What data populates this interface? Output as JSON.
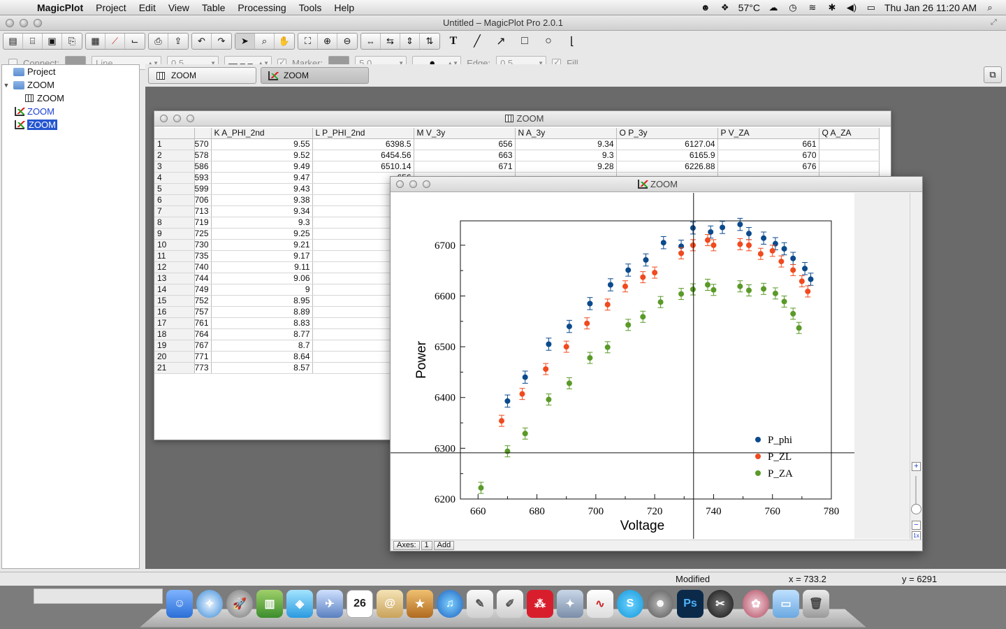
{
  "menubar": {
    "app_name": "MagicPlot",
    "items": [
      "Project",
      "Edit",
      "View",
      "Table",
      "Processing",
      "Tools",
      "Help"
    ],
    "temperature": "57°C",
    "datetime": "Thu Jan 26  11:20 AM"
  },
  "window": {
    "title": "Untitled – MagicPlot Pro 2.0.1"
  },
  "propbar": {
    "connect_label": "Connect:",
    "line_style": "Line",
    "line_width": "0.5",
    "marker_label": "Marker:",
    "marker_size": "5.0",
    "edge_label": "Edge:",
    "edge_width": "0.5",
    "fill_label": "Fill"
  },
  "project_tree": {
    "root": "Project",
    "folder": "ZOOM",
    "folder_table": "ZOOM",
    "graph1": "ZOOM",
    "graph2": "ZOOM"
  },
  "doc_tabs": [
    "ZOOM",
    "ZOOM"
  ],
  "table_window": {
    "title": "ZOOM",
    "columns": [
      "K A_PHI_2nd",
      "L P_PHI_2nd",
      "M V_3y",
      "N A_3y",
      "O P_3y",
      "P V_ZA",
      "Q A_ZA"
    ],
    "rows": [
      {
        "n": "1",
        "j": "570",
        "k": "9.55",
        "l": "6398.5",
        "m": "656",
        "nn": "9.34",
        "o": "6127.04",
        "p": "661"
      },
      {
        "n": "2",
        "j": "578",
        "k": "9.52",
        "l": "6454.56",
        "m": "663",
        "nn": "9.3",
        "o": "6165.9",
        "p": "670"
      },
      {
        "n": "3",
        "j": "586",
        "k": "9.49",
        "l": "6510.14",
        "m": "671",
        "nn": "9.28",
        "o": "6226.88",
        "p": "676"
      },
      {
        "n": "4",
        "j": "593",
        "k": "9.47",
        "l": "656",
        "m": "",
        "nn": "",
        "o": "",
        "p": ""
      },
      {
        "n": "5",
        "j": "599",
        "k": "9.43",
        "l": "659",
        "m": "",
        "nn": "",
        "o": "",
        "p": ""
      },
      {
        "n": "6",
        "j": "706",
        "k": "9.38",
        "l": "662",
        "m": "",
        "nn": "",
        "o": "",
        "p": ""
      },
      {
        "n": "7",
        "j": "713",
        "k": "9.34",
        "l": "665",
        "m": "",
        "nn": "",
        "o": "",
        "p": ""
      },
      {
        "n": "8",
        "j": "719",
        "k": "9.3",
        "l": "66",
        "m": "",
        "nn": "",
        "o": "",
        "p": ""
      },
      {
        "n": "9",
        "j": "725",
        "k": "9.25",
        "l": "670",
        "m": "",
        "nn": "",
        "o": "",
        "p": ""
      },
      {
        "n": "10",
        "j": "730",
        "k": "9.21",
        "l": "67",
        "m": "",
        "nn": "",
        "o": "",
        "p": ""
      },
      {
        "n": "11",
        "j": "735",
        "k": "9.17",
        "l": "673",
        "m": "",
        "nn": "",
        "o": "",
        "p": ""
      },
      {
        "n": "12",
        "j": "740",
        "k": "9.11",
        "l": "67",
        "m": "",
        "nn": "",
        "o": "",
        "p": ""
      },
      {
        "n": "13",
        "j": "744",
        "k": "9.06",
        "l": "674",
        "m": "",
        "nn": "",
        "o": "",
        "p": ""
      },
      {
        "n": "14",
        "j": "749",
        "k": "9",
        "l": "",
        "m": "",
        "nn": "",
        "o": "",
        "p": ""
      },
      {
        "n": "15",
        "j": "752",
        "k": "8.95",
        "l": "67",
        "m": "",
        "nn": "",
        "o": "",
        "p": ""
      },
      {
        "n": "16",
        "j": "757",
        "k": "8.89",
        "l": "672",
        "m": "",
        "nn": "",
        "o": "",
        "p": ""
      },
      {
        "n": "17",
        "j": "761",
        "k": "8.83",
        "l": "671",
        "m": "",
        "nn": "",
        "o": "",
        "p": ""
      },
      {
        "n": "18",
        "j": "764",
        "k": "8.77",
        "l": "670",
        "m": "",
        "nn": "",
        "o": "",
        "p": ""
      },
      {
        "n": "19",
        "j": "767",
        "k": "8.7",
        "l": "66",
        "m": "",
        "nn": "",
        "o": "",
        "p": ""
      },
      {
        "n": "20",
        "j": "771",
        "k": "8.64",
        "l": "666",
        "m": "",
        "nn": "",
        "o": "",
        "p": ""
      },
      {
        "n": "21",
        "j": "773",
        "k": "8.57",
        "l": "662",
        "m": "",
        "nn": "",
        "o": "",
        "p": ""
      }
    ]
  },
  "graph_window": {
    "title": "ZOOM",
    "axes_label": "Axes:",
    "axes_num": "1",
    "add_label": "Add"
  },
  "chart_data": {
    "type": "scatter",
    "xlabel": "Voltage",
    "ylabel": "Power",
    "xlim": [
      652,
      780
    ],
    "ylim": [
      6200,
      6755
    ],
    "xticks": [
      660,
      680,
      700,
      720,
      740,
      760,
      780
    ],
    "yticks": [
      6200,
      6300,
      6400,
      6500,
      6600,
      6700
    ],
    "legend_position": "bottom-right",
    "crosshair": {
      "x": 733.2,
      "y": 6291
    },
    "series": [
      {
        "name": "P_phi",
        "color": "#0b4a8c",
        "err": 12,
        "points": [
          [
            670,
            6393
          ],
          [
            676,
            6440
          ],
          [
            684,
            6505
          ],
          [
            691,
            6540
          ],
          [
            698,
            6585
          ],
          [
            705,
            6622
          ],
          [
            711,
            6651
          ],
          [
            717,
            6671
          ],
          [
            723,
            6705
          ],
          [
            729,
            6698
          ],
          [
            733,
            6734
          ],
          [
            739,
            6726
          ],
          [
            743,
            6735
          ],
          [
            749,
            6741
          ],
          [
            752,
            6723
          ],
          [
            757,
            6714
          ],
          [
            761,
            6703
          ],
          [
            764,
            6693
          ],
          [
            767,
            6674
          ],
          [
            771,
            6654
          ],
          [
            773,
            6633
          ]
        ]
      },
      {
        "name": "P_ZL",
        "color": "#f04a1e",
        "err": 11,
        "points": [
          [
            668,
            6354
          ],
          [
            675,
            6407
          ],
          [
            683,
            6456
          ],
          [
            690,
            6500
          ],
          [
            697,
            6546
          ],
          [
            704,
            6583
          ],
          [
            710,
            6619
          ],
          [
            716,
            6637
          ],
          [
            720,
            6646
          ],
          [
            729,
            6684
          ],
          [
            733,
            6700
          ],
          [
            738,
            6710
          ],
          [
            740,
            6700
          ],
          [
            749,
            6702
          ],
          [
            752,
            6700
          ],
          [
            756,
            6683
          ],
          [
            760,
            6689
          ],
          [
            763,
            6668
          ],
          [
            767,
            6651
          ],
          [
            770,
            6629
          ],
          [
            772,
            6609
          ]
        ]
      },
      {
        "name": "P_ZA",
        "color": "#5a9a28",
        "err": 11,
        "points": [
          [
            661,
            6222
          ],
          [
            670,
            6294
          ],
          [
            676,
            6329
          ],
          [
            684,
            6396
          ],
          [
            691,
            6428
          ],
          [
            698,
            6478
          ],
          [
            704,
            6499
          ],
          [
            711,
            6543
          ],
          [
            716,
            6559
          ],
          [
            722,
            6588
          ],
          [
            729,
            6604
          ],
          [
            733,
            6613
          ],
          [
            738,
            6622
          ],
          [
            740,
            6612
          ],
          [
            749,
            6619
          ],
          [
            752,
            6611
          ],
          [
            757,
            6614
          ],
          [
            761,
            6605
          ],
          [
            764,
            6589
          ],
          [
            767,
            6565
          ],
          [
            769,
            6537
          ]
        ]
      }
    ]
  },
  "statusbar": {
    "state": "Modified",
    "x_readout": "x = 733.2",
    "y_readout": "y = 6291"
  }
}
